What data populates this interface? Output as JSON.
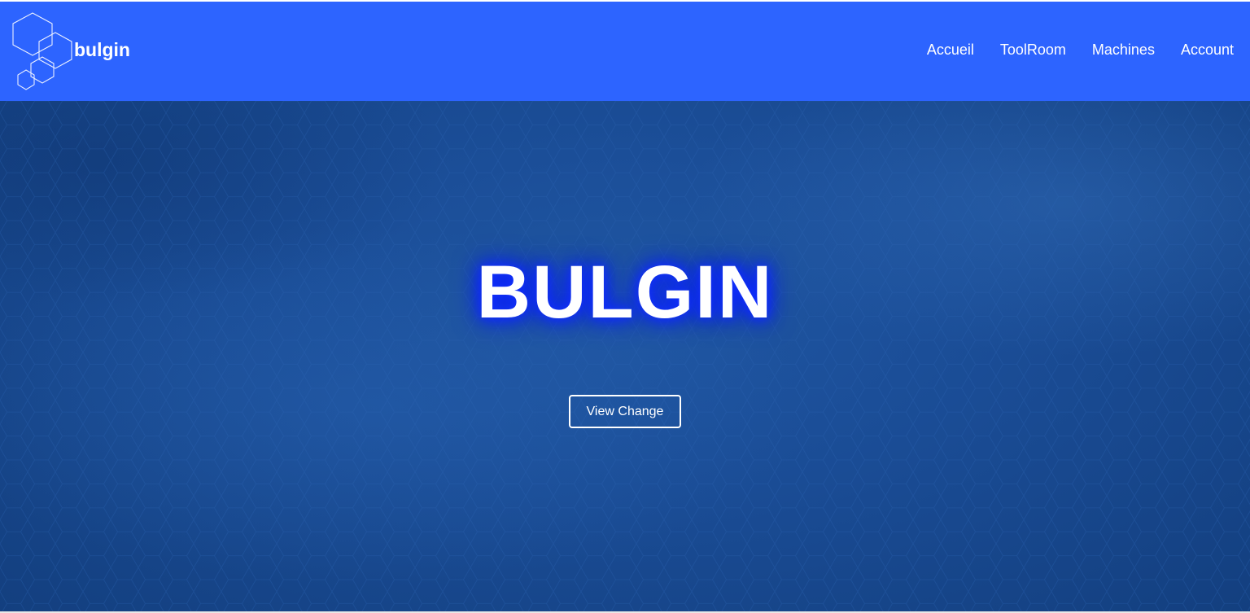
{
  "brand": {
    "name": "bulgin",
    "logo_icon": "hexagon-cluster-icon"
  },
  "nav": {
    "items": [
      {
        "label": "Accueil"
      },
      {
        "label": "ToolRoom"
      },
      {
        "label": "Machines"
      },
      {
        "label": "Account"
      }
    ]
  },
  "hero": {
    "title": "BULGIN",
    "button_label": "View Change"
  },
  "colors": {
    "navbar": "#2d64ff",
    "hero_bg": "#1a4c95",
    "title_glow": "#0a1fff",
    "text": "#ffffff"
  }
}
